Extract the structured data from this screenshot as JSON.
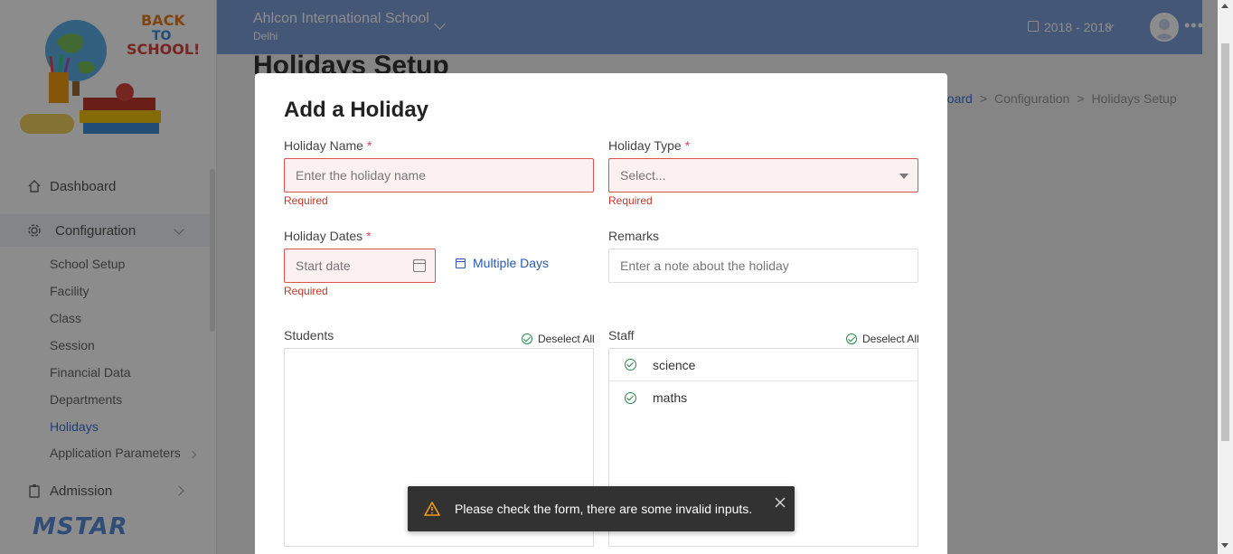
{
  "school": {
    "name": "Ahlcon International School",
    "city": "Delhi"
  },
  "academic_year": "2018 - 2018",
  "page": {
    "title": "Holidays Setup"
  },
  "breadcrumb": {
    "first": "board",
    "second": "Configuration",
    "third": "Holidays Setup"
  },
  "sidebar": {
    "dashboard": "Dashboard",
    "configuration": "Configuration",
    "submenu": [
      "School Setup",
      "Facility",
      "Class",
      "Session",
      "Financial Data",
      "Departments",
      "Holidays",
      "Application Parameters"
    ],
    "admission": "Admission",
    "brand": "MSTAR",
    "logo_text_1": "BACK",
    "logo_text_2": "TO",
    "logo_text_3": "SCHOOL!"
  },
  "modal": {
    "title": "Add a Holiday",
    "holiday_name": {
      "label": "Holiday Name",
      "placeholder": "Enter the holiday name",
      "error": "Required"
    },
    "holiday_type": {
      "label": "Holiday Type",
      "placeholder": "Select...",
      "error": "Required"
    },
    "holiday_dates": {
      "label": "Holiday Dates",
      "placeholder": "Start date",
      "error": "Required"
    },
    "multiple_days": "Multiple Days",
    "remarks": {
      "label": "Remarks",
      "placeholder": "Enter a note about the holiday"
    },
    "students": {
      "label": "Students",
      "deselect": "Deselect All",
      "items": []
    },
    "staff": {
      "label": "Staff",
      "deselect": "Deselect All",
      "items": [
        "science",
        "maths"
      ]
    }
  },
  "toast": {
    "message": "Please check the form, there are some invalid inputs."
  },
  "colors": {
    "topbar": "#7d9ed9",
    "link": "#2a59b7",
    "error": "#c0392b",
    "required": "#e0435d",
    "check": "#2a8a4a"
  }
}
